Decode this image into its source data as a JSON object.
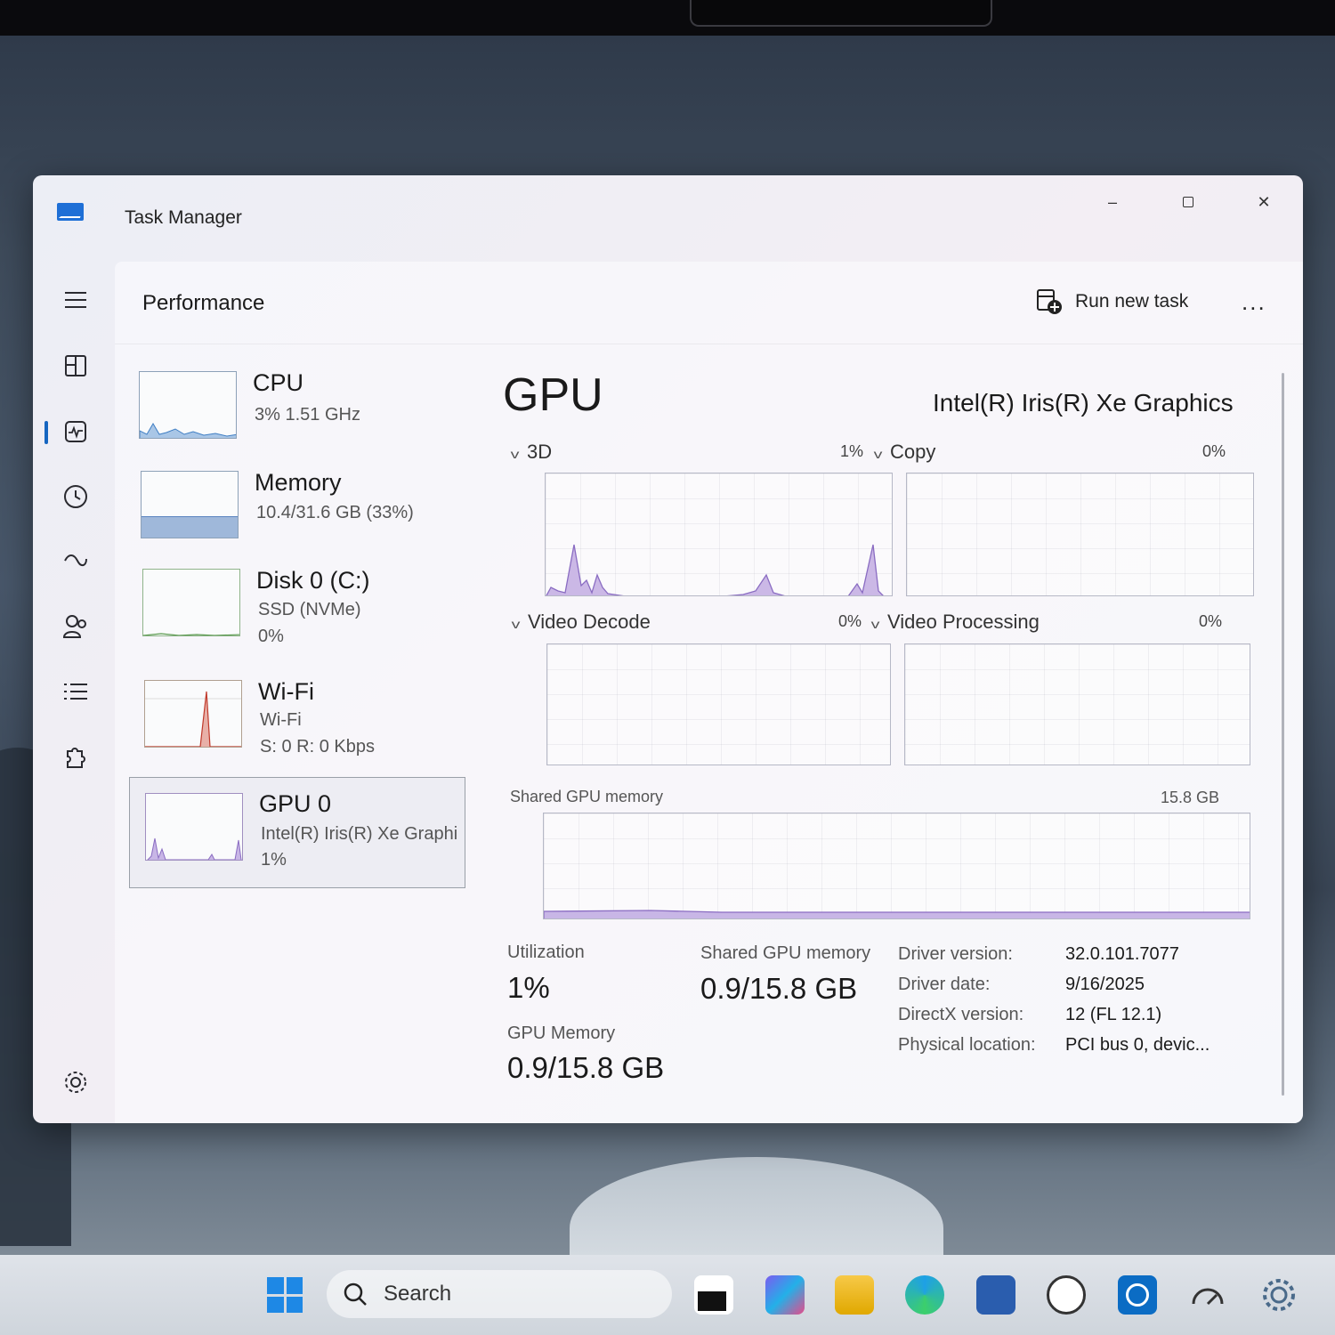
{
  "window": {
    "title": "Task Manager"
  },
  "header": {
    "page_title": "Performance",
    "run_task_label": "Run new task",
    "more_label": "..."
  },
  "devices": [
    {
      "name": "CPU",
      "line1": "3%  1.51 GHz",
      "line2": ""
    },
    {
      "name": "Memory",
      "line1": "10.4/31.6 GB (33%)",
      "line2": ""
    },
    {
      "name": "Disk 0 (C:)",
      "line1": "SSD (NVMe)",
      "line2": "0%"
    },
    {
      "name": "Wi-Fi",
      "line1": "Wi-Fi",
      "line2": "S: 0  R: 0 Kbps"
    },
    {
      "name": "GPU 0",
      "line1": "Intel(R) Iris(R) Xe Graphi",
      "line2": "1%"
    }
  ],
  "gpu": {
    "title": "GPU",
    "model": "Intel(R) Iris(R) Xe Graphics",
    "engines": [
      {
        "name": "3D",
        "pct": "1%"
      },
      {
        "name": "Copy",
        "pct": "0%"
      },
      {
        "name": "Video Decode",
        "pct": "0%"
      },
      {
        "name": "Video Processing",
        "pct": "0%"
      }
    ],
    "shared_graph_label": "Shared GPU memory",
    "shared_graph_max": "15.8 GB",
    "utilization_label": "Utilization",
    "utilization_value": "1%",
    "shared_mem_label": "Shared GPU memory",
    "shared_mem_value": "0.9/15.8 GB",
    "gpu_mem_label": "GPU Memory",
    "gpu_mem_value": "0.9/15.8 GB",
    "details": [
      {
        "key": "Driver version:",
        "value": "32.0.101.7077"
      },
      {
        "key": "Driver date:",
        "value": "9/16/2025"
      },
      {
        "key": "DirectX version:",
        "value": "12 (FL 12.1)"
      },
      {
        "key": "Physical location:",
        "value": "PCI bus 0, devic..."
      }
    ]
  },
  "taskbar": {
    "search_placeholder": "Search"
  },
  "colors": {
    "accent": "#1565c0",
    "gpu_graph": "#a98fd1",
    "memory_fill": "#9fb8da",
    "wifi_spike": "#c0392b"
  }
}
